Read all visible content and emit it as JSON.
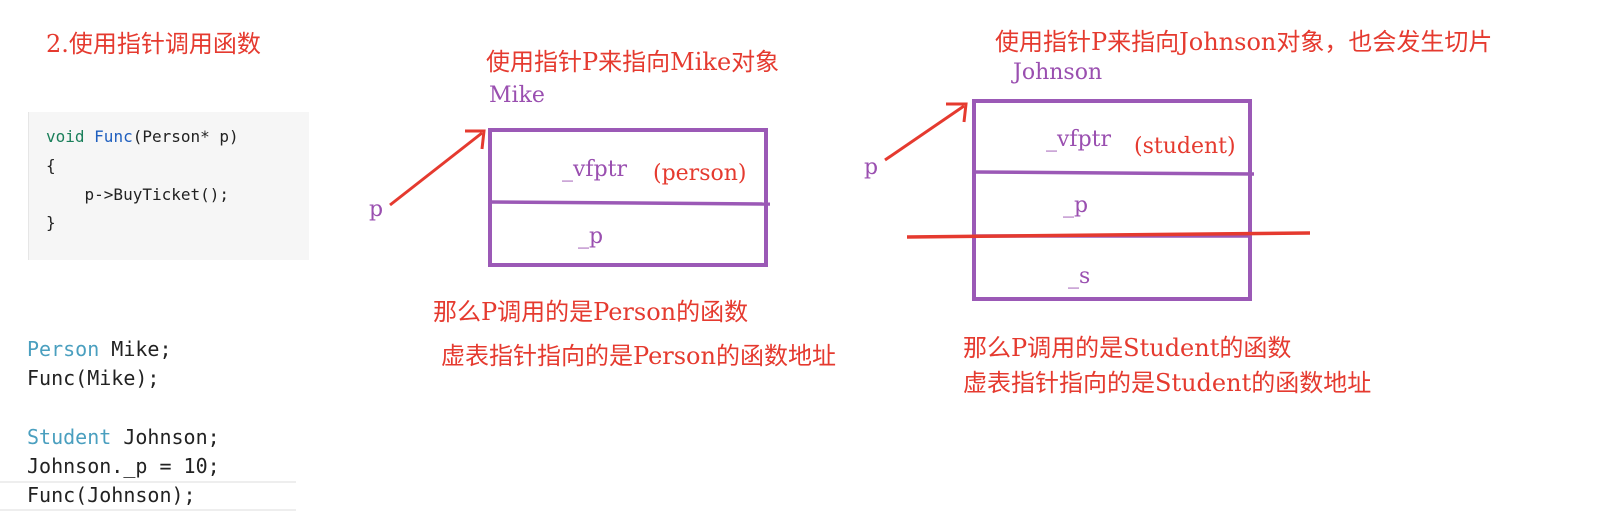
{
  "heading": "2.使用指针调用函数",
  "code_snippet": {
    "line1_kw": "void",
    "line1_fn": "Func",
    "line1_rest": "(Person* p)",
    "line2": "{",
    "line3": "    p->BuyTicket();",
    "line4": "}"
  },
  "bottom_code": {
    "l1_type": "Person",
    "l1_rest": " Mike;",
    "l2": "Func(Mike);",
    "l3_type": "Student",
    "l3_rest": " Johnson;",
    "l4": "Johnson._p = 10;",
    "l5": "Func(Johnson);"
  },
  "left_diagram": {
    "caption": "使用指针P来指向Mike对象",
    "object_name": "Mike",
    "pointer_label": "p",
    "vfptr": "_vfptr",
    "vfptr_note": "(person)",
    "member_p": "_p",
    "note1": "那么P调用的是Person的函数",
    "note2": "虚表指针指向的是Person的函数地址"
  },
  "right_diagram": {
    "caption": "使用指针P来指向Johnson对象，也会发生切片",
    "object_name": "Johnson",
    "pointer_label": "p",
    "vfptr": "_vfptr",
    "vfptr_note": "(student)",
    "member_p": "_p",
    "member_s": "_s",
    "note1": "那么P调用的是Student的函数",
    "note2": "虚表指针指向的是Student的函数地址"
  },
  "colors": {
    "annotation_red": "#e53a2f",
    "box_purple": "#9b59b6"
  }
}
